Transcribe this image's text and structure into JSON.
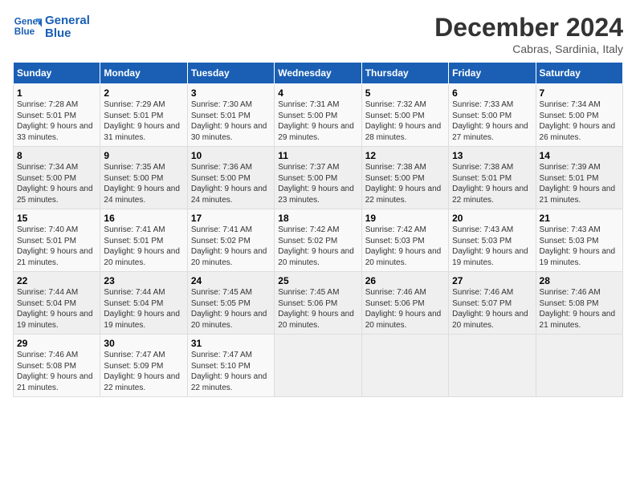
{
  "logo": {
    "line1": "General",
    "line2": "Blue"
  },
  "title": "December 2024",
  "subtitle": "Cabras, Sardinia, Italy",
  "header": {
    "colors": {
      "accent": "#1a5fb4"
    }
  },
  "days_of_week": [
    "Sunday",
    "Monday",
    "Tuesday",
    "Wednesday",
    "Thursday",
    "Friday",
    "Saturday"
  ],
  "weeks": [
    [
      {
        "day": 1,
        "sunrise": "7:28 AM",
        "sunset": "5:01 PM",
        "daylight": "9 hours and 33 minutes."
      },
      {
        "day": 2,
        "sunrise": "7:29 AM",
        "sunset": "5:01 PM",
        "daylight": "9 hours and 31 minutes."
      },
      {
        "day": 3,
        "sunrise": "7:30 AM",
        "sunset": "5:01 PM",
        "daylight": "9 hours and 30 minutes."
      },
      {
        "day": 4,
        "sunrise": "7:31 AM",
        "sunset": "5:00 PM",
        "daylight": "9 hours and 29 minutes."
      },
      {
        "day": 5,
        "sunrise": "7:32 AM",
        "sunset": "5:00 PM",
        "daylight": "9 hours and 28 minutes."
      },
      {
        "day": 6,
        "sunrise": "7:33 AM",
        "sunset": "5:00 PM",
        "daylight": "9 hours and 27 minutes."
      },
      {
        "day": 7,
        "sunrise": "7:34 AM",
        "sunset": "5:00 PM",
        "daylight": "9 hours and 26 minutes."
      }
    ],
    [
      {
        "day": 8,
        "sunrise": "7:34 AM",
        "sunset": "5:00 PM",
        "daylight": "9 hours and 25 minutes."
      },
      {
        "day": 9,
        "sunrise": "7:35 AM",
        "sunset": "5:00 PM",
        "daylight": "9 hours and 24 minutes."
      },
      {
        "day": 10,
        "sunrise": "7:36 AM",
        "sunset": "5:00 PM",
        "daylight": "9 hours and 24 minutes."
      },
      {
        "day": 11,
        "sunrise": "7:37 AM",
        "sunset": "5:00 PM",
        "daylight": "9 hours and 23 minutes."
      },
      {
        "day": 12,
        "sunrise": "7:38 AM",
        "sunset": "5:00 PM",
        "daylight": "9 hours and 22 minutes."
      },
      {
        "day": 13,
        "sunrise": "7:38 AM",
        "sunset": "5:01 PM",
        "daylight": "9 hours and 22 minutes."
      },
      {
        "day": 14,
        "sunrise": "7:39 AM",
        "sunset": "5:01 PM",
        "daylight": "9 hours and 21 minutes."
      }
    ],
    [
      {
        "day": 15,
        "sunrise": "7:40 AM",
        "sunset": "5:01 PM",
        "daylight": "9 hours and 21 minutes."
      },
      {
        "day": 16,
        "sunrise": "7:41 AM",
        "sunset": "5:01 PM",
        "daylight": "9 hours and 20 minutes."
      },
      {
        "day": 17,
        "sunrise": "7:41 AM",
        "sunset": "5:02 PM",
        "daylight": "9 hours and 20 minutes."
      },
      {
        "day": 18,
        "sunrise": "7:42 AM",
        "sunset": "5:02 PM",
        "daylight": "9 hours and 20 minutes."
      },
      {
        "day": 19,
        "sunrise": "7:42 AM",
        "sunset": "5:03 PM",
        "daylight": "9 hours and 20 minutes."
      },
      {
        "day": 20,
        "sunrise": "7:43 AM",
        "sunset": "5:03 PM",
        "daylight": "9 hours and 19 minutes."
      },
      {
        "day": 21,
        "sunrise": "7:43 AM",
        "sunset": "5:03 PM",
        "daylight": "9 hours and 19 minutes."
      }
    ],
    [
      {
        "day": 22,
        "sunrise": "7:44 AM",
        "sunset": "5:04 PM",
        "daylight": "9 hours and 19 minutes."
      },
      {
        "day": 23,
        "sunrise": "7:44 AM",
        "sunset": "5:04 PM",
        "daylight": "9 hours and 19 minutes."
      },
      {
        "day": 24,
        "sunrise": "7:45 AM",
        "sunset": "5:05 PM",
        "daylight": "9 hours and 20 minutes."
      },
      {
        "day": 25,
        "sunrise": "7:45 AM",
        "sunset": "5:06 PM",
        "daylight": "9 hours and 20 minutes."
      },
      {
        "day": 26,
        "sunrise": "7:46 AM",
        "sunset": "5:06 PM",
        "daylight": "9 hours and 20 minutes."
      },
      {
        "day": 27,
        "sunrise": "7:46 AM",
        "sunset": "5:07 PM",
        "daylight": "9 hours and 20 minutes."
      },
      {
        "day": 28,
        "sunrise": "7:46 AM",
        "sunset": "5:08 PM",
        "daylight": "9 hours and 21 minutes."
      }
    ],
    [
      {
        "day": 29,
        "sunrise": "7:46 AM",
        "sunset": "5:08 PM",
        "daylight": "9 hours and 21 minutes."
      },
      {
        "day": 30,
        "sunrise": "7:47 AM",
        "sunset": "5:09 PM",
        "daylight": "9 hours and 22 minutes."
      },
      {
        "day": 31,
        "sunrise": "7:47 AM",
        "sunset": "5:10 PM",
        "daylight": "9 hours and 22 minutes."
      },
      null,
      null,
      null,
      null
    ]
  ],
  "labels": {
    "sunrise": "Sunrise:",
    "sunset": "Sunset:",
    "daylight": "Daylight:"
  }
}
